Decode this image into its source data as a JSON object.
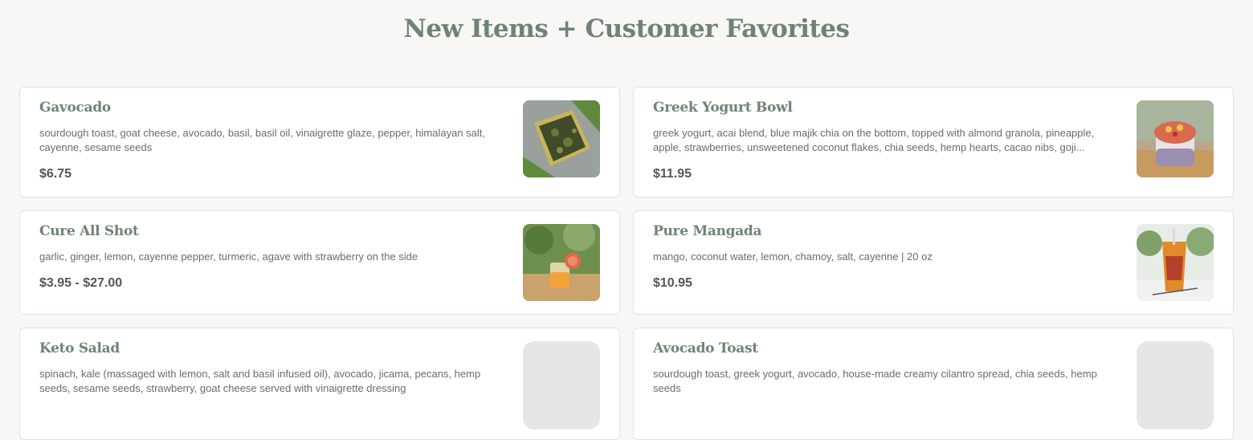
{
  "section": {
    "title": "New Items + Customer Favorites"
  },
  "items": [
    {
      "name": "Gavocado",
      "description": "sourdough toast, goat cheese, avocado, basil, basil oil, vinaigrette glaze, pepper, himalayan salt, cayenne, sesame seeds",
      "price": "$6.75",
      "image": "gavocado-photo"
    },
    {
      "name": "Greek Yogurt Bowl",
      "description": "greek yogurt, acai blend, blue majik chia on the bottom, topped with almond granola, pineapple, apple, strawberries, unsweetened coconut flakes, chia seeds, hemp hearts, cacao nibs, goji...",
      "price": "$11.95",
      "image": "greek-yogurt-bowl-photo"
    },
    {
      "name": "Cure All Shot",
      "description": "garlic, ginger, lemon, cayenne pepper, turmeric, agave with strawberry on the side",
      "price": "$3.95 - $27.00",
      "image": "cure-all-shot-photo"
    },
    {
      "name": "Pure Mangada",
      "description": "mango, coconut water, lemon, chamoy, salt, cayenne | 20 oz",
      "price": "$10.95",
      "image": "pure-mangada-photo"
    },
    {
      "name": "Keto Salad",
      "description": "spinach, kale (massaged with lemon, salt and basil infused oil), avocado, jicama, pecans, hemp seeds, sesame seeds, strawberry, goat cheese served with vinaigrette dressing",
      "price": "",
      "image": "image-placeholder"
    },
    {
      "name": "Avocado Toast",
      "description": "sourdough toast, greek yogurt, avocado, house-made creamy cilantro spread, chia seeds, hemp seeds",
      "price": "",
      "image": "image-placeholder"
    }
  ],
  "colors": {
    "heading": "#6f8373",
    "background": "#f8f7f5",
    "card": "#ffffff",
    "border": "#e3e2de",
    "price": "#555555"
  }
}
